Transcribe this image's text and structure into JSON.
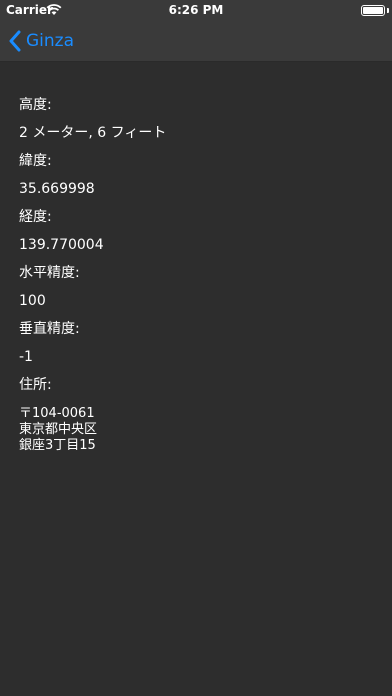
{
  "status_bar": {
    "carrier": "Carrier",
    "time": "6:26 PM",
    "battery_level": 1.0
  },
  "nav": {
    "back_label": "Ginza",
    "accent_color": "#1a8cff"
  },
  "fields": {
    "altitude_label": "高度:",
    "altitude_value": "2 メーター, 6 フィート",
    "latitude_label": "緯度:",
    "latitude_value": "35.669998",
    "longitude_label": "経度:",
    "longitude_value": "139.770004",
    "horizontal_accuracy_label": "水平精度:",
    "horizontal_accuracy_value": "100",
    "vertical_accuracy_label": "垂直精度:",
    "vertical_accuracy_value": "-1",
    "address_label": "住所:",
    "address_lines": [
      "〒104-0061",
      "東京都中央区",
      "銀座3丁目15"
    ]
  }
}
